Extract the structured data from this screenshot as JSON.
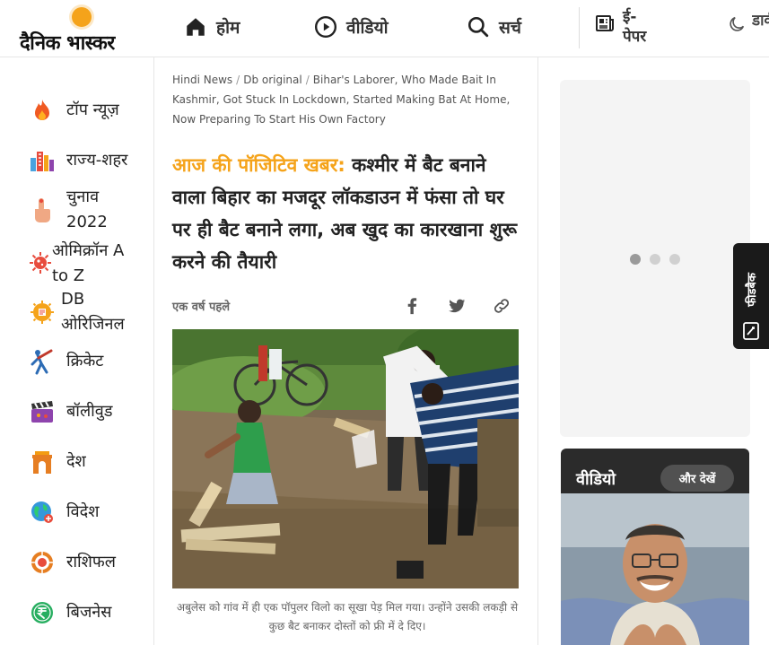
{
  "header": {
    "logo_text": "दैनिक भास्कर",
    "nav": {
      "home": "होम",
      "video": "वीडियो",
      "search": "सर्च",
      "epaper": "ई-पेपर",
      "dark_mode": "डार्क मोड"
    }
  },
  "sidebar": {
    "items": [
      {
        "label": "टॉप न्यूज़",
        "icon": "fire-icon"
      },
      {
        "label": "राज्य-शहर",
        "icon": "city-buildings-icon"
      },
      {
        "label": "चुनाव 2022",
        "icon": "voting-finger-icon"
      },
      {
        "label": "ओमिक्रॉन A to Z",
        "icon": "virus-icon"
      },
      {
        "label": "DB ओरिजिनल",
        "icon": "db-original-icon"
      },
      {
        "label": "क्रिकेट",
        "icon": "cricket-icon"
      },
      {
        "label": "बॉलीवुड",
        "icon": "clapperboard-icon"
      },
      {
        "label": "देश",
        "icon": "india-gate-icon"
      },
      {
        "label": "विदेश",
        "icon": "globe-icon"
      },
      {
        "label": "राशिफल",
        "icon": "zodiac-icon"
      },
      {
        "label": "बिजनेस",
        "icon": "rupee-icon"
      }
    ]
  },
  "article": {
    "breadcrumb": [
      "Hindi News",
      "Db original",
      "Bihar's Laborer, Who Made Bait In Kashmir, Got Stuck In Lockdown, Started Making Bat At Home, Now Preparing To Start His Own Factory"
    ],
    "kicker": "आज की पॉजिटिव खबर:",
    "headline": " कश्मीर में बैट बनाने वाला बिहार का मजदूर लॉकडाउन में फंसा तो घर पर ही बैट बनाने लगा, अब खुद का कारखाना शुरू करने की तैयारी",
    "time": "एक वर्ष पहले",
    "caption": "अबुलेस को गांव में ही एक पॉपुलर विलो का सूखा पेड़ मिल गया। उन्होंने उसकी लकड़ी से कुछ बैट बनाकर दोस्तों को फ्री में दे दिए।"
  },
  "right": {
    "feedback_label": "फीडबैक",
    "video_title": "वीडियो",
    "video_more": "और देखें"
  },
  "colors": {
    "accent": "#f5a31a",
    "dark": "#1a1a1a"
  }
}
